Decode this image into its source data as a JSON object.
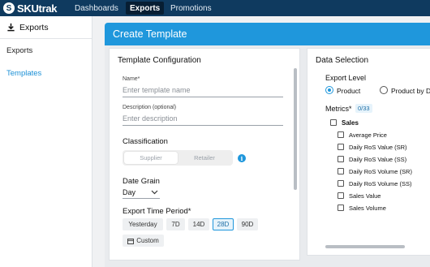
{
  "app": {
    "logo_text": "SKUtrak",
    "logo_mark": "S",
    "nav": [
      "Dashboards",
      "Exports",
      "Promotions"
    ],
    "active_nav": "Exports"
  },
  "sidebar": {
    "header": "Exports",
    "header_icon": "download-icon",
    "items": [
      {
        "label": "Exports",
        "active": false
      },
      {
        "label": "Templates",
        "active": true
      }
    ]
  },
  "page": {
    "title": "Create Template"
  },
  "template_config": {
    "title": "Template Configuration",
    "name_label": "Name*",
    "name_placeholder": "Enter template name",
    "description_label": "Description (optional)",
    "description_placeholder": "Enter description",
    "classification_label": "Classification",
    "classification_options": [
      "Supplier",
      "Retailer"
    ],
    "classification_selected": "Supplier",
    "info_icon": "info-icon",
    "date_grain_label": "Date Grain",
    "date_grain_value": "Day",
    "export_period_label": "Export Time Period*",
    "periods": [
      "Yesterday",
      "7D",
      "14D",
      "28D",
      "90D"
    ],
    "selected_period": "28D",
    "custom_label": "Custom",
    "custom_icon": "calendar-icon"
  },
  "data_selection": {
    "title": "Data Selection",
    "export_level_label": "Export Level",
    "levels": [
      "Product",
      "Product by D"
    ],
    "selected_level": "Product",
    "metrics_label": "Metrics*",
    "metrics_count": "0/33",
    "group": "Sales",
    "metrics": [
      "Average Price",
      "Daily RoS Value (SR)",
      "Daily RoS Value (SS)",
      "Daily RoS Volume (SR)",
      "Daily RoS Volume (SS)",
      "Sales Value",
      "Sales Volume"
    ]
  },
  "colors": {
    "topbar": "#0f3a5f",
    "accent": "#1f97dc",
    "active_link": "#1a8fd6"
  }
}
